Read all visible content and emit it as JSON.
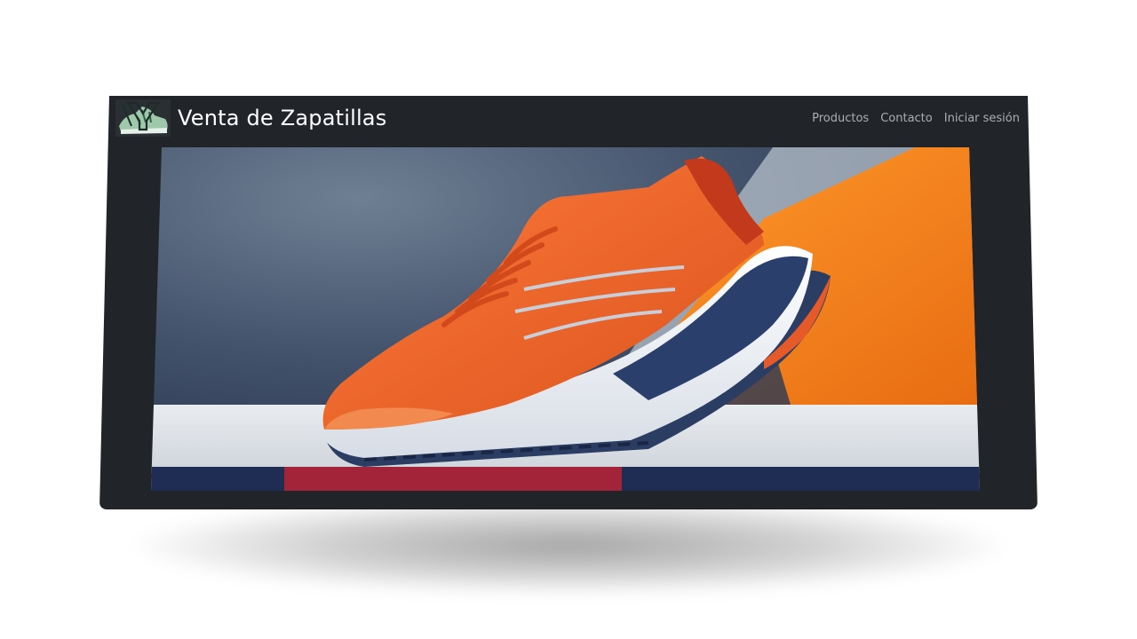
{
  "brand": {
    "title": "Venta de Zapatillas",
    "logo_icon": "sneaker-logo-icon"
  },
  "nav": {
    "items": [
      {
        "label": "Productos"
      },
      {
        "label": "Contacto"
      },
      {
        "label": "Iniciar sesión"
      }
    ]
  },
  "hero": {
    "image_icon": "orange-running-shoe-image"
  },
  "colors": {
    "navbar_bg": "#212529",
    "brand_text": "#ffffff",
    "nav_text": "#a6a8aa",
    "shoe_orange": "#ef6a2a",
    "backdrop_orange": "#f7821d",
    "backdrop_blue": "#3b4a63"
  }
}
